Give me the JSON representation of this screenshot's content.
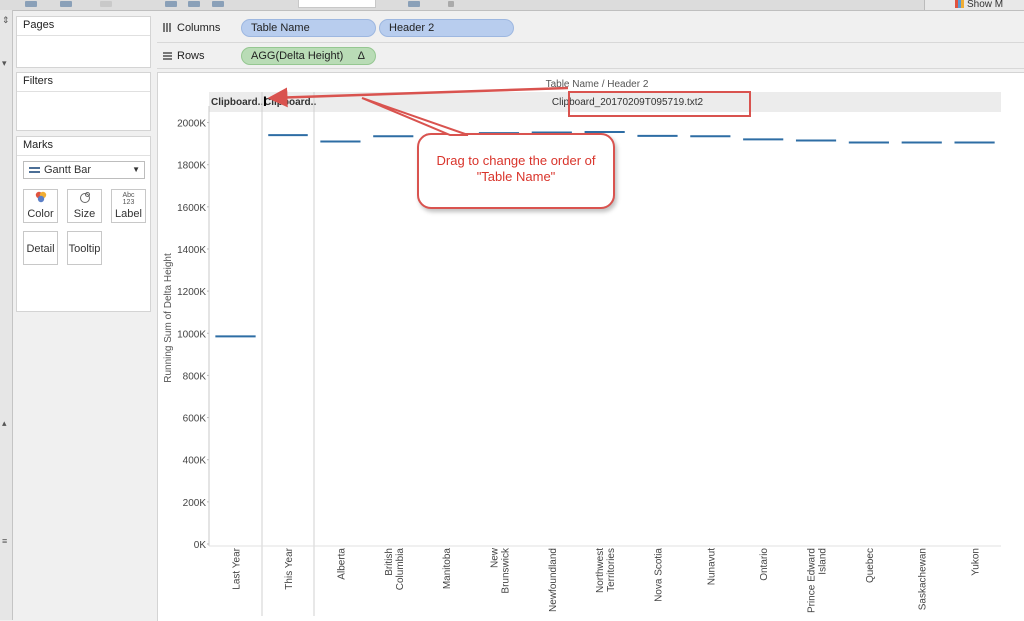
{
  "toolbar": {
    "show_me_label": "Show M"
  },
  "left_strip": {
    "glyphs": [
      "⇕",
      "▾",
      "▴",
      "≡"
    ]
  },
  "panels": {
    "pages": {
      "title": "Pages"
    },
    "filters": {
      "title": "Filters"
    },
    "marks": {
      "title": "Marks",
      "mark_type": "Gantt Bar",
      "buttons": [
        {
          "label": "Color",
          "icon": "color-icon"
        },
        {
          "label": "Size",
          "icon": "size-icon"
        },
        {
          "label": "Label",
          "icon": "label-icon"
        },
        {
          "label": "Detail",
          "icon": "detail-icon"
        },
        {
          "label": "Tooltip",
          "icon": "tooltip-icon"
        }
      ],
      "label_icon_text": "Abc\n123"
    }
  },
  "shelves": {
    "columns": {
      "label": "Columns",
      "pills": [
        "Table Name",
        "Header 2"
      ]
    },
    "rows": {
      "label": "Rows",
      "pills": [
        "AGG(Delta Height)"
      ],
      "delta_symbol": "Δ"
    }
  },
  "annotation": {
    "callout_text": "Drag to change the order of \"Table Name\"",
    "highlight": "Clipboard_20170209T095719.txt2"
  },
  "colors": {
    "mark": "#2e6da4",
    "callout": "#d9534f",
    "pill_blue": "#b8cdee",
    "pill_green": "#b9dcb6"
  },
  "chart_data": {
    "type": "gantt",
    "column_title": "Table Name  /  Header 2",
    "ylabel": "Running Sum of Delta Height",
    "ylim": [
      0,
      2050000
    ],
    "y_ticks": [
      "0K",
      "200K",
      "400K",
      "600K",
      "800K",
      "1000K",
      "1200K",
      "1400K",
      "1600K",
      "1800K",
      "2000K"
    ],
    "panes": [
      {
        "header": "Clipboard..",
        "categories": [
          "Last Year"
        ],
        "values": [
          985000
        ]
      },
      {
        "header": "Clipboard..",
        "categories": [
          "This Year"
        ],
        "values": [
          1940000
        ]
      },
      {
        "header": "Clipboard_20170209T095719.txt2",
        "categories": [
          "Alberta",
          "British Columbia",
          "Manitoba",
          "New Brunswick",
          "Newfoundland",
          "Northwest Territories",
          "Nova Scotia",
          "Nunavut",
          "Ontario",
          "Prince Edward Island",
          "Quebec",
          "Saskachewan",
          "Yukon"
        ],
        "values": [
          1910000,
          1935000,
          1942000,
          1950000,
          1953000,
          1955000,
          1937000,
          1935000,
          1920000,
          1915000,
          1905000,
          1905000,
          1905000
        ]
      }
    ]
  }
}
